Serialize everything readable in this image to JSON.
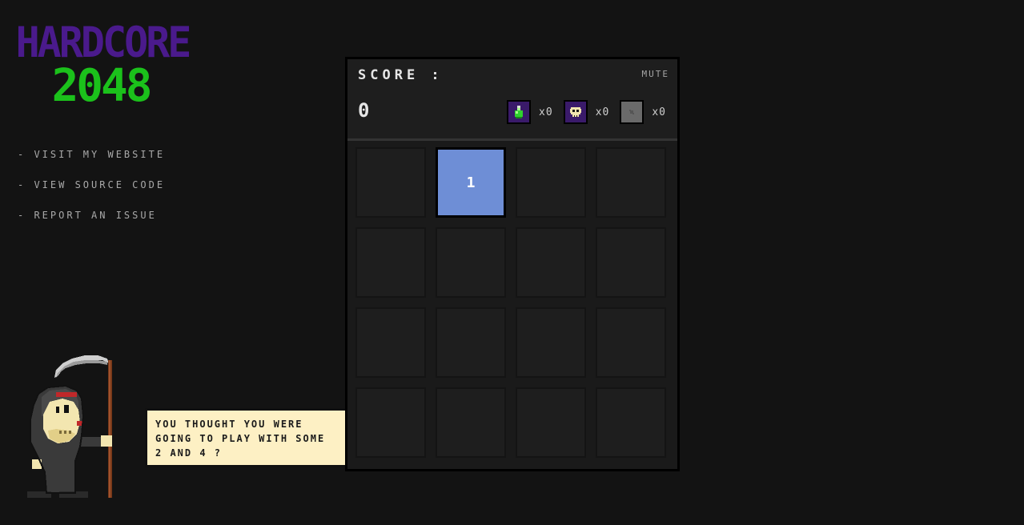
{
  "logo": {
    "line1": "HARDCORE",
    "line2": "2048"
  },
  "links": [
    {
      "label": "- VISIT MY WEBSITE"
    },
    {
      "label": "- VIEW SOURCE CODE"
    },
    {
      "label": "- REPORT AN ISSUE"
    }
  ],
  "bubble": {
    "line1": "YOU THOUGHT YOU WERE",
    "line2": "GOING TO PLAY WITH SOME",
    "line3": "2 AND 4 ?"
  },
  "header": {
    "score_label": "SCORE :",
    "mute_label": "MUTE",
    "score_value": "0"
  },
  "powerups": [
    {
      "icon": "potion-icon",
      "count": "x0",
      "color": "#3a1a6a"
    },
    {
      "icon": "skull-icon",
      "count": "x0",
      "color": "#3a1a6a"
    },
    {
      "icon": "locked-icon",
      "count": "x0",
      "color": "#6a6a6a"
    }
  ],
  "grid": {
    "rows": [
      [
        "",
        "1",
        "",
        ""
      ],
      [
        "",
        "",
        "",
        ""
      ],
      [
        "",
        "",
        "",
        ""
      ],
      [
        "",
        "",
        "",
        ""
      ]
    ]
  },
  "colors": {
    "background": "#131313",
    "logo_purple": "#4a1a8c",
    "logo_green": "#1bc11b",
    "tile_blue": "#6e8ed6",
    "bubble": "#fdf0c4"
  }
}
